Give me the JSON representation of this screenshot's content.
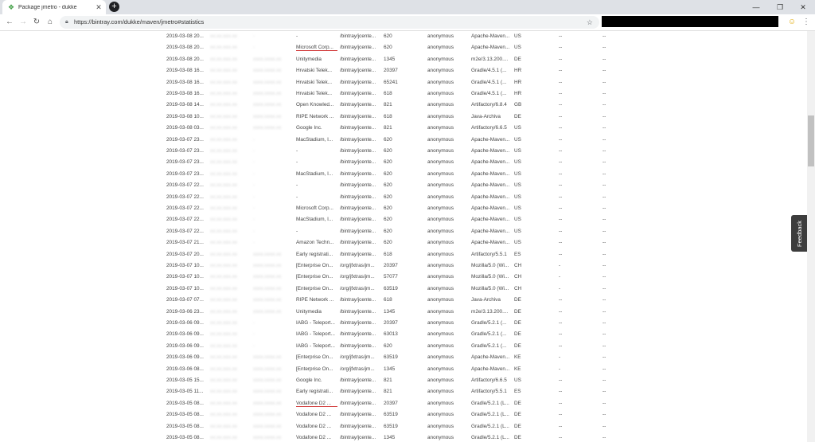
{
  "browser": {
    "tab_title": "Package jmetro - dukke",
    "new_tab": "+",
    "url": "https://bintray.com/dukke/maven/jmetro#statistics",
    "win_min": "—",
    "win_max": "❐",
    "win_close": "✕"
  },
  "feedback_label": "Feedback",
  "rows": [
    {
      "date": "2019-03-08 20...",
      "ip": "xx.xx.xxx.xx",
      "host": "-",
      "org": "-",
      "path": "/bintray/jcente...",
      "size": "620",
      "user": "anonymous",
      "agent": "Apache-Maven...",
      "cc": "US",
      "d1": "--",
      "d2": "--"
    },
    {
      "date": "2019-03-08 20...",
      "ip": "xx.xx.xxx.xx",
      "host": "-",
      "org": "Microsoft Corp...",
      "path": "/bintray/jcente...",
      "size": "620",
      "user": "anonymous",
      "agent": "Apache-Maven...",
      "cc": "US",
      "d1": "--",
      "d2": "--"
    },
    {
      "date": "2019-03-08 20...",
      "ip": "xx.xx.xxx.xx",
      "host": "xxxx.xxxx.xx",
      "org": "Unitymedia",
      "path": "/bintray/jcente...",
      "size": "1345",
      "user": "anonymous",
      "agent": "m2e/3.13.200....",
      "cc": "DE",
      "d1": "--",
      "d2": "--"
    },
    {
      "date": "2019-03-08 16...",
      "ip": "xx.xx.xxx.xx",
      "host": "xxxx.xxxx.xx",
      "org": "Hrvatski Telek...",
      "path": "/bintray/jcente...",
      "size": "20397",
      "user": "anonymous",
      "agent": "Gradle/4.5.1 (...",
      "cc": "HR",
      "d1": "--",
      "d2": "--"
    },
    {
      "date": "2019-03-08 16...",
      "ip": "xx.xx.xxx.xx",
      "host": "xxxx.xxxx.xx",
      "org": "Hrvatski Telek...",
      "path": "/bintray/jcente...",
      "size": "65241",
      "user": "anonymous",
      "agent": "Gradle/4.5.1 (...",
      "cc": "HR",
      "d1": "--",
      "d2": "--"
    },
    {
      "date": "2019-03-08 16...",
      "ip": "xx.xx.xxx.xx",
      "host": "xxxx.xxxx.xx",
      "org": "Hrvatski Telek...",
      "path": "/bintray/jcente...",
      "size": "618",
      "user": "anonymous",
      "agent": "Gradle/4.5.1 (...",
      "cc": "HR",
      "d1": "--",
      "d2": "--"
    },
    {
      "date": "2019-03-08 14...",
      "ip": "xx.xx.xxx.xx",
      "host": "xxxx.xxxx.xx",
      "org": "Open Knowled...",
      "path": "/bintray/jcente...",
      "size": "821",
      "user": "anonymous",
      "agent": "Artifactory/6.8.4",
      "cc": "GB",
      "d1": "--",
      "d2": "--"
    },
    {
      "date": "2019-03-08 10...",
      "ip": "xx.xx.xxx.xx",
      "host": "xxxx.xxxx.xx",
      "org": "RIPE Network ...",
      "path": "/bintray/jcente...",
      "size": "618",
      "user": "anonymous",
      "agent": "Java-Archiva",
      "cc": "DE",
      "d1": "--",
      "d2": "--"
    },
    {
      "date": "2019-03-08 03...",
      "ip": "xx.xx.xxx.xx",
      "host": "xxxx.xxxx.xx",
      "org": "Google Inc.",
      "path": "/bintray/jcente...",
      "size": "821",
      "user": "anonymous",
      "agent": "Artifactory/6.6.5",
      "cc": "US",
      "d1": "--",
      "d2": "--"
    },
    {
      "date": "2019-03-07 23...",
      "ip": "xx.xx.xxx.xx",
      "host": "-",
      "org": "MacStadium, I...",
      "path": "/bintray/jcente...",
      "size": "620",
      "user": "anonymous",
      "agent": "Apache-Maven...",
      "cc": "US",
      "d1": "--",
      "d2": "--"
    },
    {
      "date": "2019-03-07 23...",
      "ip": "xx.xx.xxx.xx",
      "host": "-",
      "org": "-",
      "path": "/bintray/jcente...",
      "size": "620",
      "user": "anonymous",
      "agent": "Apache-Maven...",
      "cc": "US",
      "d1": "--",
      "d2": "--"
    },
    {
      "date": "2019-03-07 23...",
      "ip": "xx.xx.xxx.xx",
      "host": "-",
      "org": "-",
      "path": "/bintray/jcente...",
      "size": "620",
      "user": "anonymous",
      "agent": "Apache-Maven...",
      "cc": "US",
      "d1": "--",
      "d2": "--"
    },
    {
      "date": "2019-03-07 23...",
      "ip": "xx.xx.xxx.xx",
      "host": "-",
      "org": "MacStadium, I...",
      "path": "/bintray/jcente...",
      "size": "620",
      "user": "anonymous",
      "agent": "Apache-Maven...",
      "cc": "US",
      "d1": "--",
      "d2": "--"
    },
    {
      "date": "2019-03-07 22...",
      "ip": "xx.xx.xxx.xx",
      "host": "-",
      "org": "-",
      "path": "/bintray/jcente...",
      "size": "620",
      "user": "anonymous",
      "agent": "Apache-Maven...",
      "cc": "US",
      "d1": "--",
      "d2": "--"
    },
    {
      "date": "2019-03-07 22...",
      "ip": "xx.xx.xxx.xx",
      "host": "-",
      "org": "-",
      "path": "/bintray/jcente...",
      "size": "620",
      "user": "anonymous",
      "agent": "Apache-Maven...",
      "cc": "US",
      "d1": "--",
      "d2": "--"
    },
    {
      "date": "2019-03-07 22...",
      "ip": "xx.xx.xxx.xx",
      "host": "-",
      "org": "Microsoft Corp...",
      "path": "/bintray/jcente...",
      "size": "620",
      "user": "anonymous",
      "agent": "Apache-Maven...",
      "cc": "US",
      "d1": "--",
      "d2": "--"
    },
    {
      "date": "2019-03-07 22...",
      "ip": "xx.xx.xxx.xx",
      "host": "-",
      "org": "MacStadium, I...",
      "path": "/bintray/jcente...",
      "size": "620",
      "user": "anonymous",
      "agent": "Apache-Maven...",
      "cc": "US",
      "d1": "--",
      "d2": "--"
    },
    {
      "date": "2019-03-07 22...",
      "ip": "xx.xx.xxx.xx",
      "host": "-",
      "org": "-",
      "path": "/bintray/jcente...",
      "size": "620",
      "user": "anonymous",
      "agent": "Apache-Maven...",
      "cc": "US",
      "d1": "--",
      "d2": "--"
    },
    {
      "date": "2019-03-07 21...",
      "ip": "xx.xx.xxx.xx",
      "host": "-",
      "org": "Amazon Techn...",
      "path": "/bintray/jcente...",
      "size": "620",
      "user": "anonymous",
      "agent": "Apache-Maven...",
      "cc": "US",
      "d1": "--",
      "d2": "--"
    },
    {
      "date": "2019-03-07 20...",
      "ip": "xx.xx.xxx.xx",
      "host": "xxxx.xxxx.xx",
      "org": "Early registrati...",
      "path": "/bintray/jcente...",
      "size": "618",
      "user": "anonymous",
      "agent": "Artifactory/5.5.1",
      "cc": "ES",
      "d1": "--",
      "d2": "--"
    },
    {
      "date": "2019-03-07 10...",
      "ip": "xx.xx.xxx.xx",
      "host": "xxxx.xxxx.xx",
      "org": "[Enterprise On...",
      "path": "/org/jfxtras/jm...",
      "size": "20397",
      "user": "anonymous",
      "agent": "Mozilla/5.0 (Wi...",
      "cc": "CH",
      "d1": "-",
      "d2": "--"
    },
    {
      "date": "2019-03-07 10...",
      "ip": "xx.xx.xxx.xx",
      "host": "xxxx.xxxx.xx",
      "org": "[Enterprise On...",
      "path": "/org/jfxtras/jm...",
      "size": "57077",
      "user": "anonymous",
      "agent": "Mozilla/5.0 (Wi...",
      "cc": "CH",
      "d1": "-",
      "d2": "--"
    },
    {
      "date": "2019-03-07 10...",
      "ip": "xx.xx.xxx.xx",
      "host": "xxxx.xxxx.xx",
      "org": "[Enterprise On...",
      "path": "/org/jfxtras/jm...",
      "size": "63519",
      "user": "anonymous",
      "agent": "Mozilla/5.0 (Wi...",
      "cc": "CH",
      "d1": "-",
      "d2": "--"
    },
    {
      "date": "2019-03-07 07...",
      "ip": "xx.xx.xxx.xx",
      "host": "xxxx.xxxx.xx",
      "org": "RIPE Network ...",
      "path": "/bintray/jcente...",
      "size": "618",
      "user": "anonymous",
      "agent": "Java-Archiva",
      "cc": "DE",
      "d1": "--",
      "d2": "--"
    },
    {
      "date": "2019-03-06 23...",
      "ip": "xx.xx.xxx.xx",
      "host": "xxxx.xxxx.xx",
      "org": "Unitymedia",
      "path": "/bintray/jcente...",
      "size": "1345",
      "user": "anonymous",
      "agent": "m2e/3.13.200....",
      "cc": "DE",
      "d1": "--",
      "d2": "--"
    },
    {
      "date": "2019-03-06 09...",
      "ip": "xx.xx.xxx.xx",
      "host": "-",
      "org": "IABG - Teleport...",
      "path": "/bintray/jcente...",
      "size": "20397",
      "user": "anonymous",
      "agent": "Gradle/5.2.1 (...",
      "cc": "DE",
      "d1": "--",
      "d2": "--"
    },
    {
      "date": "2019-03-06 09...",
      "ip": "xx.xx.xxx.xx",
      "host": "-",
      "org": "IABG - Teleport...",
      "path": "/bintray/jcente...",
      "size": "63013",
      "user": "anonymous",
      "agent": "Gradle/5.2.1 (...",
      "cc": "DE",
      "d1": "--",
      "d2": "--"
    },
    {
      "date": "2019-03-06 09...",
      "ip": "xx.xx.xxx.xx",
      "host": "-",
      "org": "IABG - Teleport...",
      "path": "/bintray/jcente...",
      "size": "620",
      "user": "anonymous",
      "agent": "Gradle/5.2.1 (...",
      "cc": "DE",
      "d1": "--",
      "d2": "--"
    },
    {
      "date": "2019-03-06 09...",
      "ip": "xx.xx.xxx.xx",
      "host": "xxxx.xxxx.xx",
      "org": "[Enterprise On...",
      "path": "/org/jfxtras/jm...",
      "size": "63519",
      "user": "anonymous",
      "agent": "Apache-Maven...",
      "cc": "KE",
      "d1": "-",
      "d2": "--"
    },
    {
      "date": "2019-03-06 08...",
      "ip": "xx.xx.xxx.xx",
      "host": "xxxx.xxxx.xx",
      "org": "[Enterprise On...",
      "path": "/org/jfxtras/jm...",
      "size": "1345",
      "user": "anonymous",
      "agent": "Apache-Maven...",
      "cc": "KE",
      "d1": "-",
      "d2": "--"
    },
    {
      "date": "2019-03-05 15...",
      "ip": "xx.xx.xxx.xx",
      "host": "xxxx.xxxx.xx",
      "org": "Google Inc.",
      "path": "/bintray/jcente...",
      "size": "821",
      "user": "anonymous",
      "agent": "Artifactory/6.6.5",
      "cc": "US",
      "d1": "--",
      "d2": "--"
    },
    {
      "date": "2019-03-05 11...",
      "ip": "xx.xx.xxx.xx",
      "host": "xxxx.xxxx.xx",
      "org": "Early registrati...",
      "path": "/bintray/jcente...",
      "size": "821",
      "user": "anonymous",
      "agent": "Artifactory/5.5.1",
      "cc": "ES",
      "d1": "--",
      "d2": "--"
    },
    {
      "date": "2019-03-05 08...",
      "ip": "xx.xx.xxx.xx",
      "host": "xxxx.xxxx.xx",
      "org": "Vodafone D2 ...",
      "path": "/bintray/jcente...",
      "size": "20397",
      "user": "anonymous",
      "agent": "Gradle/5.2.1 (L...",
      "cc": "DE",
      "d1": "--",
      "d2": "--"
    },
    {
      "date": "2019-03-05 08...",
      "ip": "xx.xx.xxx.xx",
      "host": "xxxx.xxxx.xx",
      "org": "Vodafone D2 ...",
      "path": "/bintray/jcente...",
      "size": "63519",
      "user": "anonymous",
      "agent": "Gradle/5.2.1 (L...",
      "cc": "DE",
      "d1": "--",
      "d2": "--"
    },
    {
      "date": "2019-03-05 08...",
      "ip": "xx.xx.xxx.xx",
      "host": "xxxx.xxxx.xx",
      "org": "Vodafone D2 ...",
      "path": "/bintray/jcente...",
      "size": "63519",
      "user": "anonymous",
      "agent": "Gradle/5.2.1 (L...",
      "cc": "DE",
      "d1": "--",
      "d2": "--"
    },
    {
      "date": "2019-03-05 08...",
      "ip": "xx.xx.xxx.xx",
      "host": "xxxx.xxxx.xx",
      "org": "Vodafone D2 ...",
      "path": "/bintray/jcente...",
      "size": "1345",
      "user": "anonymous",
      "agent": "Gradle/5.2.1 (L...",
      "cc": "DE",
      "d1": "--",
      "d2": "--"
    }
  ]
}
